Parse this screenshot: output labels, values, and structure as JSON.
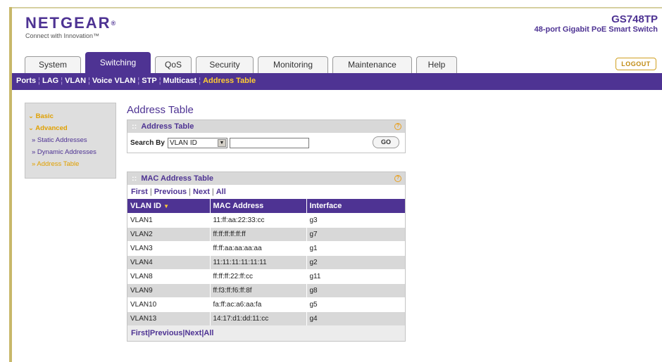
{
  "header": {
    "logo_text": "NETGEAR",
    "logo_reg": "®",
    "tagline": "Connect with Innovation™",
    "model_name": "GS748TP",
    "model_desc": "48-port Gigabit PoE Smart Switch"
  },
  "tabs": [
    {
      "label": "System"
    },
    {
      "label": "Switching"
    },
    {
      "label": "QoS"
    },
    {
      "label": "Security"
    },
    {
      "label": "Monitoring"
    },
    {
      "label": "Maintenance"
    },
    {
      "label": "Help"
    }
  ],
  "logout_label": "LOGOUT",
  "subnav": [
    "Ports",
    "LAG",
    "VLAN",
    "Voice VLAN",
    "STP",
    "Multicast",
    "Address Table"
  ],
  "sidebar": {
    "basic": "Basic",
    "advanced": "Advanced",
    "items": [
      "» Static Addresses",
      "» Dynamic Addresses",
      "» Address Table"
    ]
  },
  "page_title": "Address Table",
  "search_panel": {
    "title": "Address Table",
    "search_by_label": "Search By",
    "search_by_value": "VLAN ID",
    "search_value": "",
    "go_label": "GO"
  },
  "mac_panel": {
    "title": "MAC Address Table",
    "pager": {
      "first": "First",
      "previous": "Previous",
      "next": "Next",
      "all": "All"
    },
    "columns": [
      "VLAN ID",
      "MAC Address",
      "Interface"
    ],
    "rows": [
      [
        "VLAN1",
        "11:ff:aa:22:33:cc",
        "g3"
      ],
      [
        "VLAN2",
        "ff:ff:ff:ff:ff:ff",
        "g7"
      ],
      [
        "VLAN3",
        "ff:ff:aa:aa:aa:aa",
        "g1"
      ],
      [
        "VLAN4",
        "11:11:11:11:11:11",
        "g2"
      ],
      [
        "VLAN8",
        "ff:ff:ff:22:ff:cc",
        "g11"
      ],
      [
        "VLAN9",
        "ff:f3:ff:f6:ff:8f",
        "g8"
      ],
      [
        "VLAN10",
        "fa:ff:ac:a6:aa:fa",
        "g5"
      ],
      [
        "VLAN13",
        "14:17:d1:dd:11:cc",
        "g4"
      ]
    ]
  },
  "colors": {
    "brand_purple": "#4e3393",
    "accent_orange": "#e0a000"
  }
}
